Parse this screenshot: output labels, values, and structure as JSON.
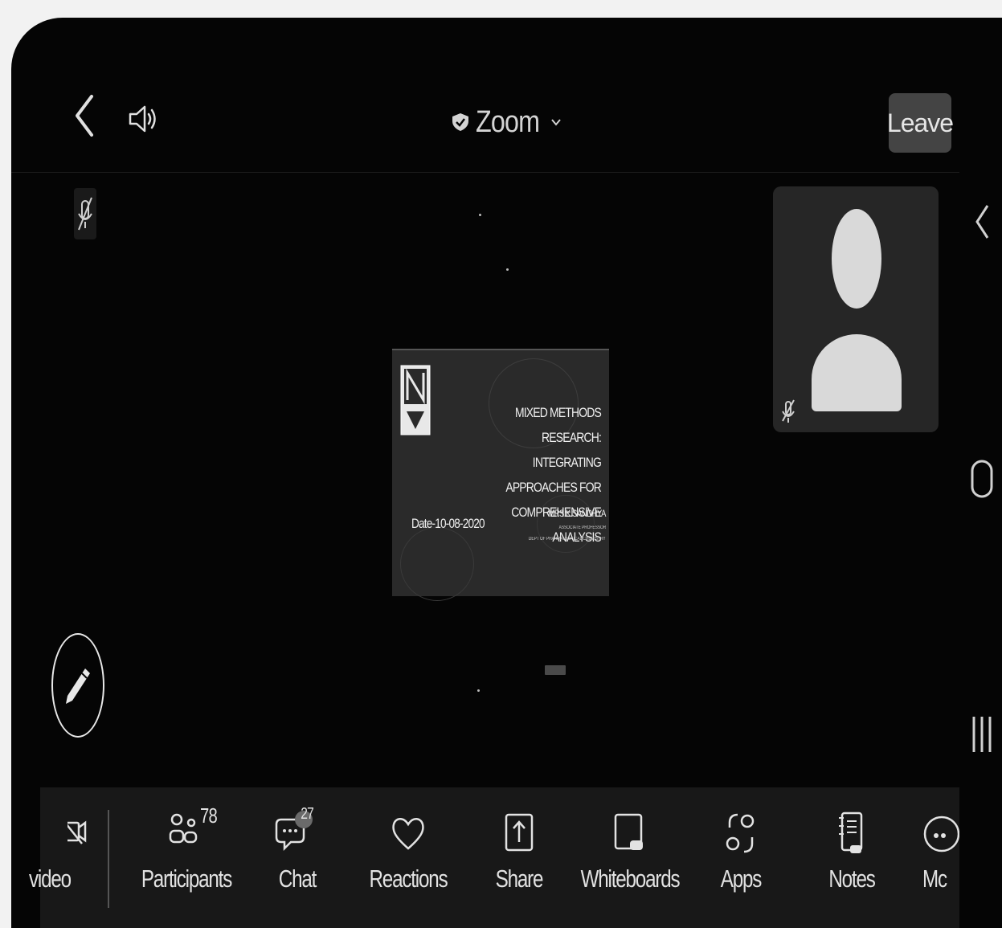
{
  "header": {
    "title": "Zoom",
    "leave_label": "Leave"
  },
  "shared_screen": {
    "slide_title": "MIXED METHODS RESEARCH:\nINTEGRATING APPROACHES FOR\nCOMPREHENSIVE ANALYSIS",
    "date_text": "Date-10-08-2020",
    "author": "MRS.K.SANDHYA",
    "designation": "ASSOCIATE PROFESSOR",
    "department": "DEPT OF PHARMACEUTICAL CHEMISTRY"
  },
  "toolbar": {
    "video_label": "video",
    "participants_label": "Participants",
    "participants_count": "78",
    "chat_label": "Chat",
    "chat_count": "27",
    "reactions_label": "Reactions",
    "share_label": "Share",
    "whiteboards_label": "Whiteboards",
    "apps_label": "Apps",
    "notes_label": "Notes",
    "more_label": "Mc"
  },
  "icons": {
    "back": "chevron-left-icon",
    "speaker": "speaker-icon",
    "security": "shield-icon",
    "mic_muted": "mic-muted-icon",
    "annotate": "pencil-icon"
  },
  "colors": {
    "background": "#050505",
    "toolbar": "#181818",
    "leave_button": "#444444",
    "text": "#e2e2e2"
  }
}
